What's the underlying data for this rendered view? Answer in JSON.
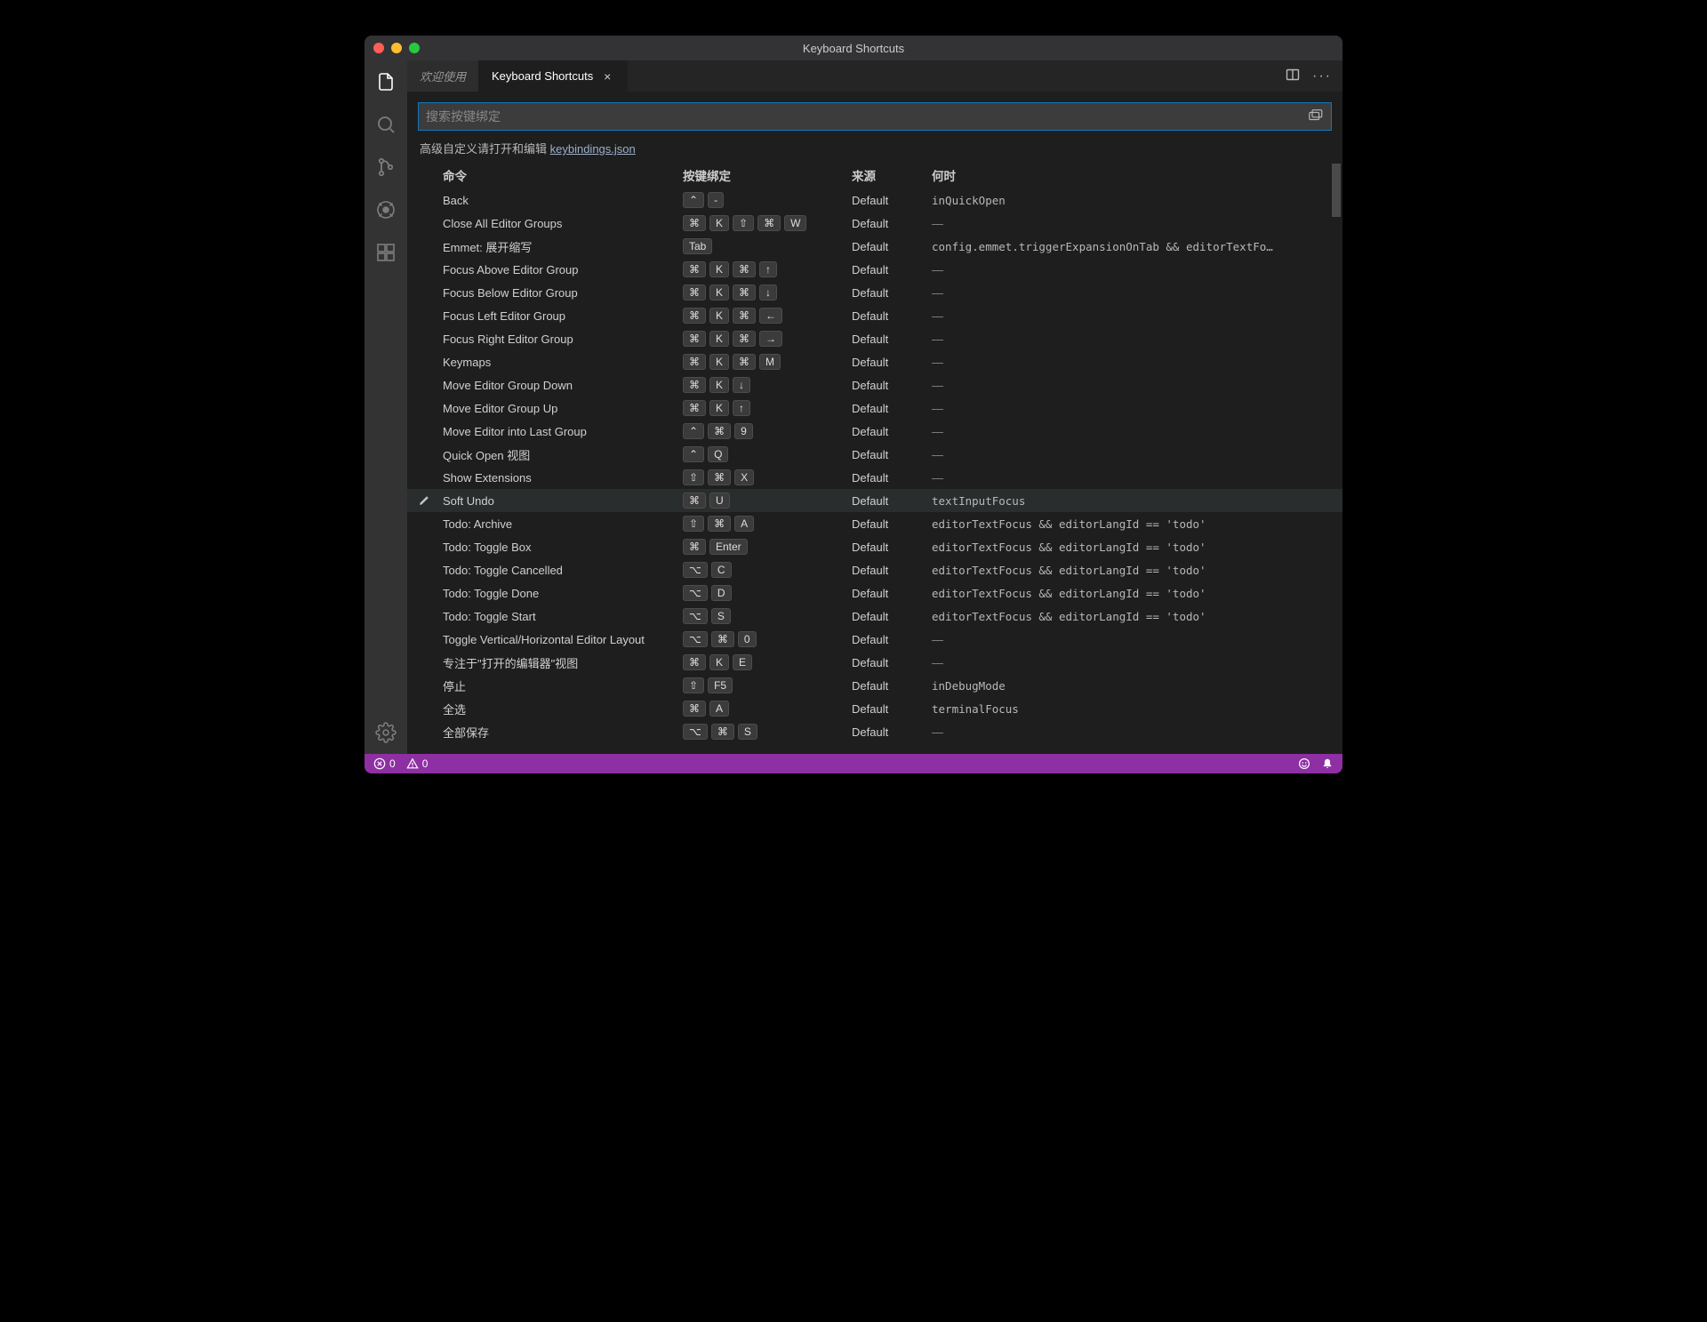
{
  "window": {
    "title": "Keyboard Shortcuts"
  },
  "tabs": {
    "items": [
      {
        "label": "欢迎使用",
        "close": "×"
      },
      {
        "label": "Keyboard Shortcuts",
        "close": "×"
      }
    ]
  },
  "search": {
    "placeholder": "搜索按键绑定"
  },
  "hint": {
    "prefix": "高级自定义请打开和编辑 ",
    "link": "keybindings.json"
  },
  "columns": {
    "command": "命令",
    "key": "按键绑定",
    "source": "来源",
    "when": "何时"
  },
  "status": {
    "errors": "0",
    "warnings": "0"
  },
  "activitybar": {
    "explorer": "explorer-icon",
    "search": "search-icon",
    "scm": "source-control-icon",
    "debug": "debug-icon",
    "extensions": "extensions-icon",
    "settings": "settings-gear-icon"
  },
  "rows": [
    {
      "cmd": "Back",
      "keys": [
        "⌃",
        "-"
      ],
      "src": "Default",
      "when": "inQuickOpen"
    },
    {
      "cmd": "Close All Editor Groups",
      "keys": [
        "⌘",
        "K",
        "⇧",
        "⌘",
        "W"
      ],
      "src": "Default",
      "when": "—"
    },
    {
      "cmd": "Emmet: 展开缩写",
      "keys": [
        "Tab"
      ],
      "src": "Default",
      "when": "config.emmet.triggerExpansionOnTab && editorTextFo…"
    },
    {
      "cmd": "Focus Above Editor Group",
      "keys": [
        "⌘",
        "K",
        "⌘",
        "↑"
      ],
      "src": "Default",
      "when": "—"
    },
    {
      "cmd": "Focus Below Editor Group",
      "keys": [
        "⌘",
        "K",
        "⌘",
        "↓"
      ],
      "src": "Default",
      "when": "—"
    },
    {
      "cmd": "Focus Left Editor Group",
      "keys": [
        "⌘",
        "K",
        "⌘",
        "←"
      ],
      "src": "Default",
      "when": "—"
    },
    {
      "cmd": "Focus Right Editor Group",
      "keys": [
        "⌘",
        "K",
        "⌘",
        "→"
      ],
      "src": "Default",
      "when": "—"
    },
    {
      "cmd": "Keymaps",
      "keys": [
        "⌘",
        "K",
        "⌘",
        "M"
      ],
      "src": "Default",
      "when": "—"
    },
    {
      "cmd": "Move Editor Group Down",
      "keys": [
        "⌘",
        "K",
        "↓"
      ],
      "src": "Default",
      "when": "—"
    },
    {
      "cmd": "Move Editor Group Up",
      "keys": [
        "⌘",
        "K",
        "↑"
      ],
      "src": "Default",
      "when": "—"
    },
    {
      "cmd": "Move Editor into Last Group",
      "keys": [
        "⌃",
        "⌘",
        "9"
      ],
      "src": "Default",
      "when": "—"
    },
    {
      "cmd": "Quick Open 视图",
      "keys": [
        "⌃",
        "Q"
      ],
      "src": "Default",
      "when": "—"
    },
    {
      "cmd": "Show Extensions",
      "keys": [
        "⇧",
        "⌘",
        "X"
      ],
      "src": "Default",
      "when": "—"
    },
    {
      "cmd": "Soft Undo",
      "keys": [
        "⌘",
        "U"
      ],
      "src": "Default",
      "when": "textInputFocus",
      "hovered": true
    },
    {
      "cmd": "Todo: Archive",
      "keys": [
        "⇧",
        "⌘",
        "A"
      ],
      "src": "Default",
      "when": "editorTextFocus && editorLangId == 'todo'"
    },
    {
      "cmd": "Todo: Toggle Box",
      "keys": [
        "⌘",
        "Enter"
      ],
      "src": "Default",
      "when": "editorTextFocus && editorLangId == 'todo'"
    },
    {
      "cmd": "Todo: Toggle Cancelled",
      "keys": [
        "⌥",
        "C"
      ],
      "src": "Default",
      "when": "editorTextFocus && editorLangId == 'todo'"
    },
    {
      "cmd": "Todo: Toggle Done",
      "keys": [
        "⌥",
        "D"
      ],
      "src": "Default",
      "when": "editorTextFocus && editorLangId == 'todo'"
    },
    {
      "cmd": "Todo: Toggle Start",
      "keys": [
        "⌥",
        "S"
      ],
      "src": "Default",
      "when": "editorTextFocus && editorLangId == 'todo'"
    },
    {
      "cmd": "Toggle Vertical/Horizontal Editor Layout",
      "keys": [
        "⌥",
        "⌘",
        "0"
      ],
      "src": "Default",
      "when": "—"
    },
    {
      "cmd": "专注于\"打开的编辑器\"视图",
      "keys": [
        "⌘",
        "K",
        "E"
      ],
      "src": "Default",
      "when": "—"
    },
    {
      "cmd": "停止",
      "keys": [
        "⇧",
        "F5"
      ],
      "src": "Default",
      "when": "inDebugMode"
    },
    {
      "cmd": "全选",
      "keys": [
        "⌘",
        "A"
      ],
      "src": "Default",
      "when": "terminalFocus"
    },
    {
      "cmd": "全部保存",
      "keys": [
        "⌥",
        "⌘",
        "S"
      ],
      "src": "Default",
      "when": "—"
    }
  ]
}
